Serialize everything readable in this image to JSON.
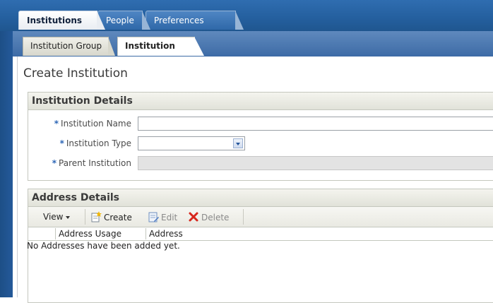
{
  "main_tabs": [
    {
      "label": "Institutions",
      "active": true
    },
    {
      "label": "People",
      "active": false
    },
    {
      "label": "Preferences",
      "active": false
    }
  ],
  "sub_tabs": [
    {
      "label": "Institution Group",
      "active": false
    },
    {
      "label": "Institution",
      "active": true
    }
  ],
  "page": {
    "title": "Create Institution"
  },
  "institution_details": {
    "heading": "Institution Details",
    "required_marker": "*",
    "fields": {
      "name": {
        "label": "Institution Name",
        "value": ""
      },
      "type": {
        "label": "Institution Type",
        "value": ""
      },
      "parent": {
        "label": "Parent Institution",
        "value": ""
      }
    }
  },
  "address_details": {
    "heading": "Address Details",
    "toolbar": {
      "view_label": "View",
      "create_label": "Create",
      "edit_label": "Edit",
      "delete_label": "Delete"
    },
    "columns": [
      "Address Usage",
      "Address"
    ],
    "empty_message": "No Addresses have been added yet."
  },
  "colors": {
    "header_blue": "#245f9e",
    "required_blue": "#2c66b6",
    "delete_red": "#d7261c"
  },
  "icons": [
    "chevron-down-icon",
    "create-icon",
    "edit-icon",
    "delete-icon"
  ]
}
